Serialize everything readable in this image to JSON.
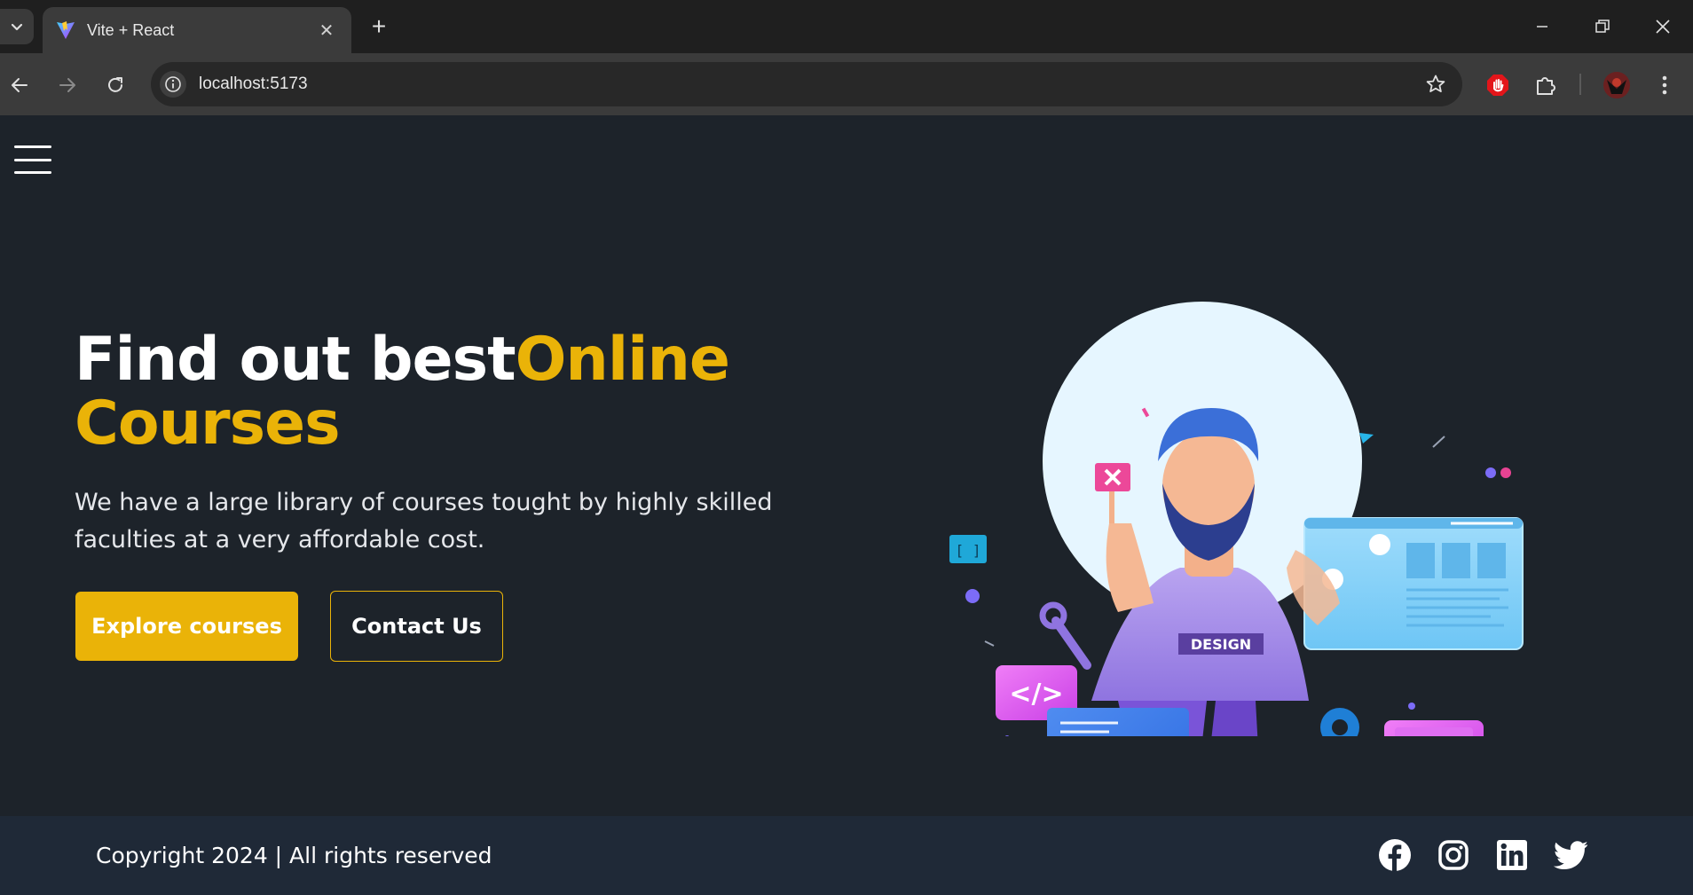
{
  "browser": {
    "tab_title": "Vite + React",
    "tab_close": "✕",
    "new_tab": "+",
    "url": "localhost:5173"
  },
  "hero": {
    "title_plain": "Find out best",
    "title_accent": "Online Courses",
    "description": "We have a large library of courses tought by highly skilled faculties at a very affordable cost.",
    "primary_button": "Explore courses",
    "secondary_button": "Contact Us",
    "illustration_badge": "DESIGN",
    "illustration_code_tag": "</>"
  },
  "footer": {
    "copyright": "Copyright 2024 | All rights reserved",
    "social_icons": [
      "facebook-icon",
      "instagram-icon",
      "linkedin-icon",
      "twitter-icon"
    ]
  },
  "colors": {
    "background": "#1d232a",
    "footer_bg": "#1f2937",
    "accent": "#eab308",
    "text": "#ffffff"
  }
}
